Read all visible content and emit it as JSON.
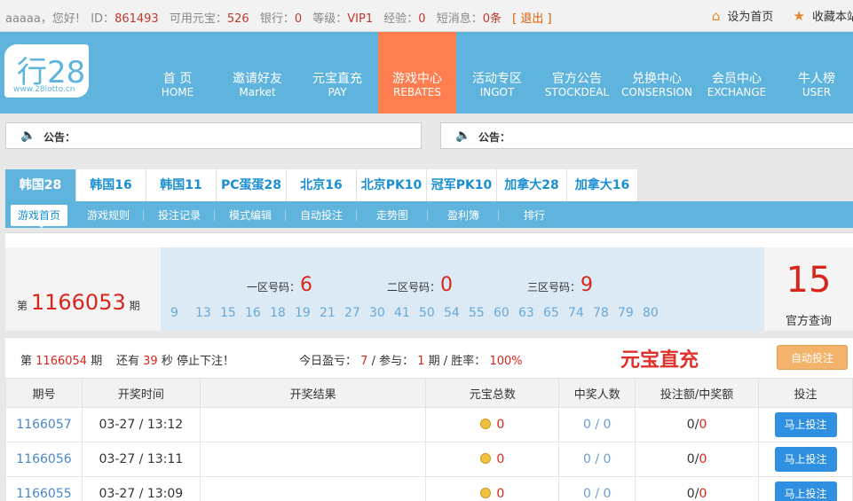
{
  "topbar": {
    "username": "aaaaa",
    "greeting": "，您好!",
    "id_label": "ID：",
    "id_value": "861493",
    "credit_label": "可用元宝：",
    "credit_value": "526",
    "bank_label": "银行：",
    "bank_value": "0",
    "level_label": "等级：",
    "level_value": "VIP1",
    "exp_label": "经验：",
    "exp_value": "0",
    "msg_label": "短消息：",
    "msg_value": "0条",
    "logout": "[ 退出 ]",
    "set_home": "设为首页",
    "favorite": "收藏本站"
  },
  "logo": {
    "big": "行28",
    "small": "www.28lotto.cn"
  },
  "nav": {
    "items": [
      {
        "cn": "首 页",
        "en": "HOME"
      },
      {
        "cn": "邀请好友",
        "en": "Market"
      },
      {
        "cn": "元宝直充",
        "en": "PAY"
      },
      {
        "cn": "游戏中心",
        "en": "REBATES"
      },
      {
        "cn": "活动专区",
        "en": "INGOT"
      },
      {
        "cn": "官方公告",
        "en": "STOCKDEAL"
      },
      {
        "cn": "兑换中心",
        "en": "CONSERSION"
      },
      {
        "cn": "会员中心",
        "en": "EXCHANGE"
      },
      {
        "cn": "牛人榜",
        "en": "USER"
      }
    ]
  },
  "notices": [
    {
      "label": "公告："
    },
    {
      "label": "公告："
    }
  ],
  "game_tabs": [
    "韩国28",
    "韩国16",
    "韩国11",
    "PC蛋蛋28",
    "北京16",
    "北京PK10",
    "冠军PK10",
    "加拿大28",
    "加拿大16"
  ],
  "sub_tabs": [
    "游戏首页",
    "游戏规则",
    "投注记录",
    "模式编辑",
    "自动投注",
    "走势图",
    "盈利簿",
    "排行"
  ],
  "draw": {
    "period_prefix": "第",
    "period_number": "1166053",
    "period_suffix": "期",
    "zone1_label": "一区号码：",
    "zone1_value": "6",
    "zone2_label": "二区号码：",
    "zone2_value": "0",
    "zone3_label": "三区号码：",
    "zone3_value": "9",
    "numbers": [
      "9",
      "13",
      "15",
      "16",
      "18",
      "19",
      "21",
      "27",
      "30",
      "41",
      "50",
      "54",
      "55",
      "60",
      "63",
      "65",
      "74",
      "78",
      "79",
      "80"
    ],
    "result": "15",
    "result_caption": "官方查询"
  },
  "status": {
    "prefix": "第",
    "next_period": "1166054",
    "period_word": "期",
    "remain_pre": "还有",
    "remain_seconds": "39",
    "remain_post": "秒 停止下注！",
    "profit_label": "今日盈亏：",
    "profit_value": "7",
    "join_label": "/ 参与：",
    "join_value": "1",
    "rate_label": "期 / 胜率：",
    "rate_value": "100%",
    "recharge": "元宝直充",
    "auto_bet": "自动投注"
  },
  "table": {
    "headers": [
      "期号",
      "开奖时间",
      "开奖结果",
      "元宝总数",
      "中奖人数",
      "投注额/中奖额",
      "投注"
    ],
    "rows": [
      {
        "period": "1166057",
        "time": "03-27 / 13:12",
        "result": "",
        "total": "0",
        "winners": "0 / 0",
        "bet": "0",
        "win": "0",
        "action": "马上投注"
      },
      {
        "period": "1166056",
        "time": "03-27 / 13:11",
        "result": "",
        "total": "0",
        "winners": "0 / 0",
        "bet": "0",
        "win": "0",
        "action": "马上投注"
      },
      {
        "period": "1166055",
        "time": "03-27 / 13:09",
        "result": "",
        "total": "0",
        "winners": "0 / 0",
        "bet": "0",
        "win": "0",
        "action": "马上投注"
      }
    ]
  },
  "colors": {
    "nav_bg": "#5fb4dd",
    "nav_active": "#ff7e50",
    "accent_red": "#d9261c",
    "button_blue": "#2f8fe0"
  }
}
